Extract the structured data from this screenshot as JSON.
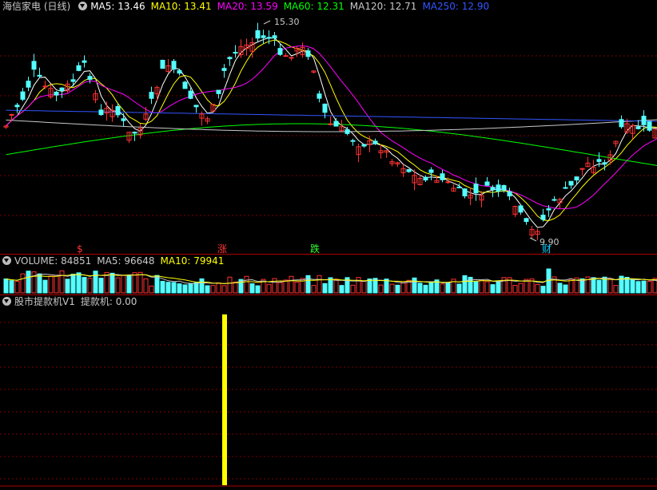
{
  "price_panel": {
    "title": "海信家电 (日线)",
    "ma": [
      {
        "label": "MA5: 13.46",
        "color": "#ffffff"
      },
      {
        "label": "MA10: 13.41",
        "color": "#ffff00"
      },
      {
        "label": "MA20: 13.59",
        "color": "#ff00ff"
      },
      {
        "label": "MA60: 12.31",
        "color": "#00ff00"
      },
      {
        "label": "MA120: 12.71",
        "color": "#c8c8c8"
      },
      {
        "label": "MA250: 12.90",
        "color": "#3355ff"
      }
    ],
    "high_label": "15.30",
    "low_label": "9.90",
    "markers": [
      {
        "text": "$",
        "color": "#ff3333"
      },
      {
        "text": "涨",
        "color": "#ff3333"
      },
      {
        "text": "跌",
        "color": "#33ff33"
      },
      {
        "text": "财",
        "color": "#00ccff"
      }
    ]
  },
  "volume_panel": {
    "label": "VOLUME: 84851",
    "ma5": "MA5: 96648",
    "ma10": "MA10: 79941",
    "colors": {
      "label": "#c8c8c8",
      "ma5": "#c8c8c8",
      "ma10": "#ffff00"
    }
  },
  "indicator_panel": {
    "title": "股市提款机V1",
    "value": "提款机: 0.00"
  },
  "colors": {
    "up": "#ff3232",
    "down": "#54ffff",
    "signal_bar": "#ffff00",
    "grid": "#8b0000"
  }
}
